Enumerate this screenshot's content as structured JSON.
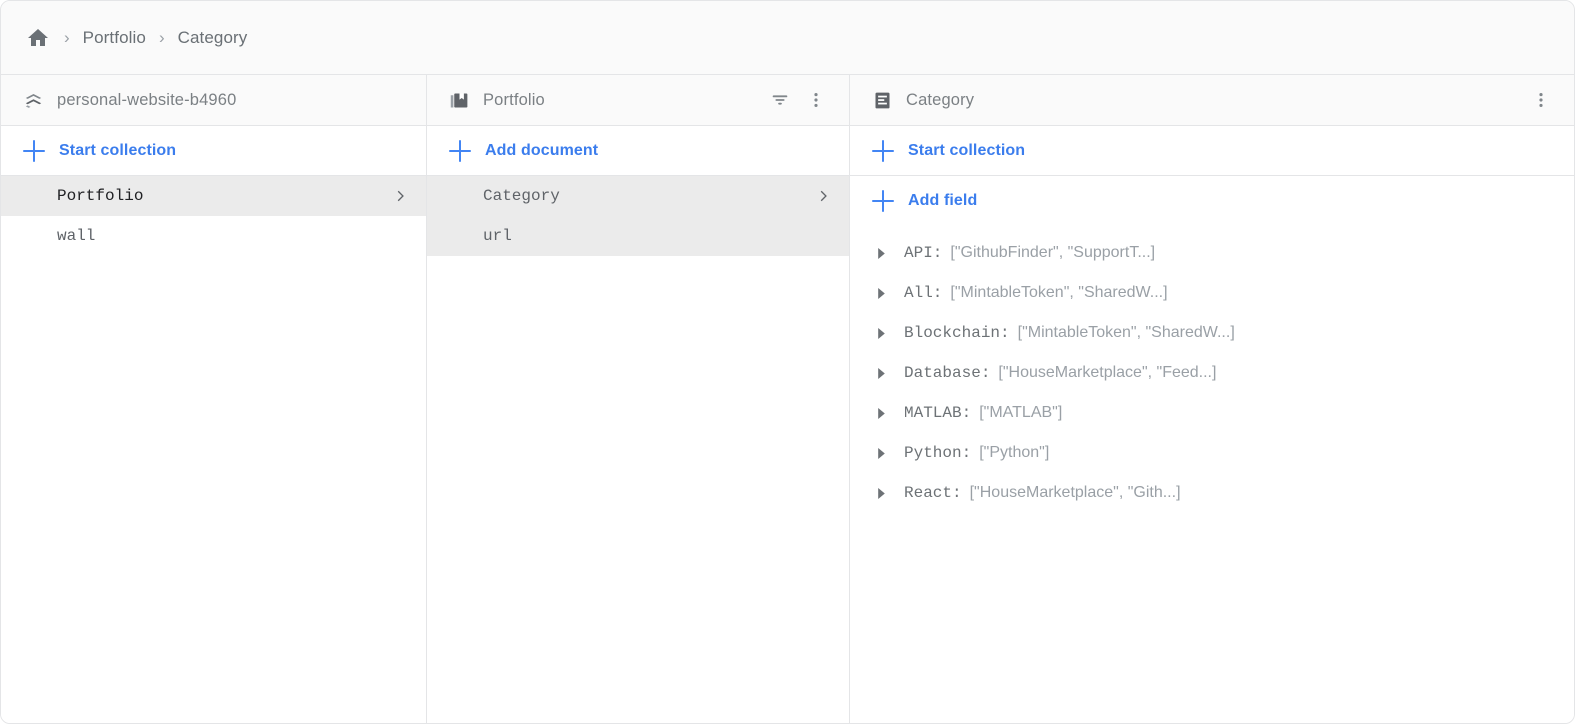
{
  "breadcrumb": {
    "home_icon": "home-icon",
    "separator": "›",
    "items": [
      {
        "label": "Portfolio"
      },
      {
        "label": "Category"
      }
    ]
  },
  "panels": {
    "project": {
      "icon": "firestore-project-icon",
      "title": "personal-website-b4960",
      "action_label": "Start collection",
      "action_icon": "plus-icon",
      "rows": [
        {
          "label": "Portfolio",
          "selected": true,
          "has_chevron": true
        },
        {
          "label": "wall",
          "selected": false,
          "has_chevron": false
        }
      ]
    },
    "collection": {
      "icon": "collection-icon",
      "title": "Portfolio",
      "filter_icon": "filter-icon",
      "menu_icon": "more-vert-icon",
      "action_label": "Add document",
      "action_icon": "plus-icon",
      "rows": [
        {
          "label": "Category",
          "selected": true,
          "has_chevron": true
        },
        {
          "label": "url",
          "selected": true,
          "has_chevron": false
        }
      ]
    },
    "document": {
      "icon": "document-icon",
      "title": "Category",
      "menu_icon": "more-vert-icon",
      "start_collection_label": "Start collection",
      "add_field_label": "Add field",
      "action_icon": "plus-icon",
      "caret_icon": "caret-right-icon",
      "fields": [
        {
          "key": "API:",
          "value": "[\"GithubFinder\", \"SupportT...]"
        },
        {
          "key": "All:",
          "value": "[\"MintableToken\", \"SharedW...]"
        },
        {
          "key": "Blockchain:",
          "value": "[\"MintableToken\", \"SharedW...]"
        },
        {
          "key": "Database:",
          "value": "[\"HouseMarketplace\", \"Feed...]"
        },
        {
          "key": "MATLAB:",
          "value": "[\"MATLAB\"]"
        },
        {
          "key": "Python:",
          "value": "[\"Python\"]"
        },
        {
          "key": "React:",
          "value": "[\"HouseMarketplace\", \"Gith...]"
        }
      ]
    }
  },
  "colors": {
    "accent_blue": "#3b7ded",
    "plus_blue": "#4285f4",
    "selected_gray": "#ebebeb",
    "header_gray": "#fafafa",
    "border_gray": "#e4e5e7",
    "text_gray": "#6d7276",
    "value_gray": "#9aa0a6"
  }
}
